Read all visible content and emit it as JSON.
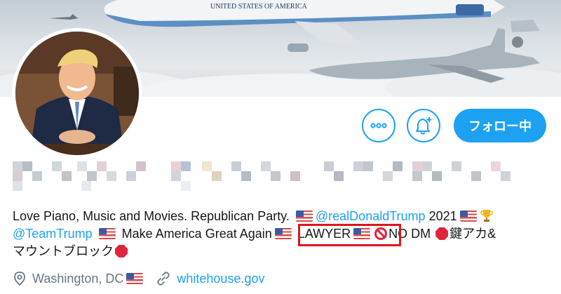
{
  "header": {
    "plane_text": "UNITED STATES OF AMERICA",
    "accent_color": "#1da1f2"
  },
  "actions": {
    "more_icon": "more-dots-icon",
    "bell_icon": "bell-plus-icon",
    "follow_label": "フォロー中"
  },
  "profile": {
    "display_name_censored": true
  },
  "bio": {
    "line1_text": "Love Piano, Music and Movies. Republican Party.",
    "mention1": "@realDonaldTrump",
    "year": "2021",
    "mention2": "@TeamTrump",
    "slogan": "Make America Great Again",
    "lawyer": "LAWYER",
    "no_dm": "NO DM",
    "lock_text": "鍵アカ&",
    "line3_text": "マウントブロック"
  },
  "meta": {
    "location": "Washington, DC",
    "website": "whitehouse.gov"
  }
}
